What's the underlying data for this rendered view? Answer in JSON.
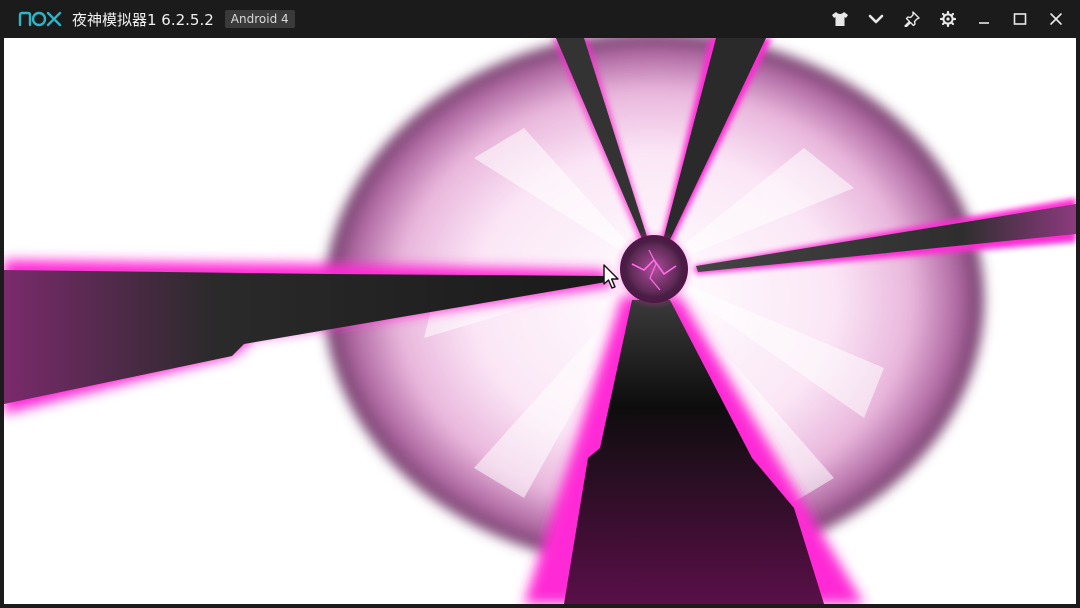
{
  "window": {
    "title": "夜神模拟器1 6.2.5.2",
    "android_badge": "Android 4",
    "logo_text": "nox"
  },
  "controls": [
    {
      "icon": "shirt-icon"
    },
    {
      "icon": "chevron-down-icon"
    },
    {
      "icon": "pin-icon"
    },
    {
      "icon": "gear-icon"
    },
    {
      "icon": "minimize-icon"
    },
    {
      "icon": "maximize-icon"
    },
    {
      "icon": "close-icon"
    }
  ],
  "colors": {
    "titlebar_bg": "#1b1b1b",
    "logo": "#2fb3c7",
    "glow_magenta": "#ff2bd6",
    "orb_purple": "#8a2f7a",
    "beam_dark": "#111111"
  }
}
